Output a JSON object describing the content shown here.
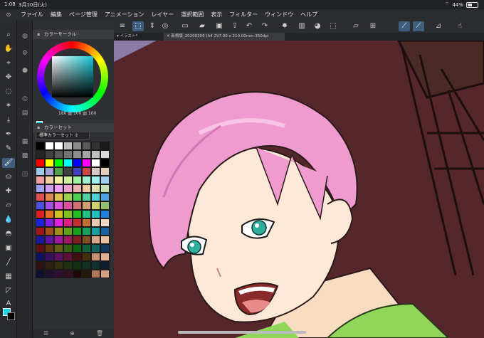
{
  "status_bar": {
    "time": "1:08",
    "date": "3月10日(火)",
    "battery": "44%",
    "battery_level": 0.44
  },
  "menu": [
    "ファイル",
    "編集",
    "ページ管理",
    "アニメーション",
    "レイヤー",
    "選択範囲",
    "表示",
    "フィルター",
    "ウィンドウ",
    "ヘルプ"
  ],
  "panels": {
    "color_wheel": {
      "title": "カラーサークル",
      "hsv": "180 100 100",
      "hsv_h": "180",
      "hsv_s": "100",
      "hsv_v": "100"
    },
    "color_set": {
      "title": "カラーセット",
      "set_name": "標準カラーセット",
      "swatches": [
        "#000000",
        "#ffffff",
        "#ffffff",
        "#bfbfbf",
        "#8c8c8c",
        "#595959",
        "#333333",
        "#1a1a1a",
        "#262626",
        "#404040",
        "#595959",
        "#737373",
        "#8c8c8c",
        "#a6a6a6",
        "#bfbfbf",
        "#d9d9d9",
        "#ff0000",
        "#ffff00",
        "#00ff00",
        "#00ffff",
        "#0000ff",
        "#ff00ff",
        "#ffffff",
        "#000000",
        "#9ec8e8",
        "#a0a0d8",
        "#50a050",
        "#404040",
        "#4040c0",
        "#c84848",
        "#d8c8c8",
        "#e0d0b8",
        "#f0a0a0",
        "#f0d0a0",
        "#f0f0a0",
        "#d0f0a0",
        "#a0f0a0",
        "#a0f0d0",
        "#a0f0f0",
        "#a0d0f0",
        "#a0a0f0",
        "#d0a0f0",
        "#f0a0f0",
        "#f0a0d0",
        "#f0b0b0",
        "#f0c8a0",
        "#e0e0b0",
        "#c8e0b0",
        "#e05050",
        "#e08850",
        "#e0c050",
        "#a0d050",
        "#50d050",
        "#50d0a0",
        "#50d0d0",
        "#50a0e0",
        "#5050e0",
        "#a050e0",
        "#e050e0",
        "#e050a0",
        "#d07070",
        "#d0a070",
        "#d0d070",
        "#90c070",
        "#e02020",
        "#e07020",
        "#d0c020",
        "#80c020",
        "#20c020",
        "#20c080",
        "#20c0c0",
        "#2080e0",
        "#2020e0",
        "#8020e0",
        "#e020e0",
        "#e02080",
        "#c03030",
        "#c07030",
        "#e8c8b0",
        "#f0d8c0",
        "#a01818",
        "#a05018",
        "#a09018",
        "#60a018",
        "#18a018",
        "#18a060",
        "#18a0a0",
        "#1860a0",
        "#1818a0",
        "#6018a0",
        "#a018a0",
        "#a01860",
        "#802020",
        "#805020",
        "#d8a888",
        "#e8c0a0",
        "#601010",
        "#603810",
        "#606010",
        "#386010",
        "#106010",
        "#106038",
        "#106060",
        "#103860",
        "#101060",
        "#381060",
        "#601060",
        "#601038",
        "#401010",
        "#403010",
        "#c89070",
        "#e0b090",
        "#301010",
        "#302010",
        "#303010",
        "#203010",
        "#103010",
        "#103020",
        "#103030",
        "#102030",
        "#101030",
        "#201030",
        "#301030",
        "#301020",
        "#200808",
        "#201808",
        "#b07858",
        "#d8a080"
      ]
    }
  },
  "command_bar": {
    "buttons": [
      "menu-icon",
      "selection-tool-icon",
      "arrange-icon",
      "new-icon",
      "open-icon",
      "save-icon",
      "undo-icon",
      "redo-icon",
      "clear-icon",
      "fill-icon",
      "transform-icon",
      "deselect-icon",
      "snap-ruler-icon",
      "snap-special-ruler-icon",
      "snap-grid-icon",
      "hand-icon"
    ]
  },
  "tabs": [
    {
      "label": "イラスト*",
      "active": false
    },
    {
      "label": "新規版_20200306 (A4 297.00 x 210.00mm 350dpi 130.2%)",
      "active": true
    }
  ],
  "current_colors": {
    "main": "#19d8ea",
    "sub": "#000000"
  },
  "accent": "#3f5e7e"
}
